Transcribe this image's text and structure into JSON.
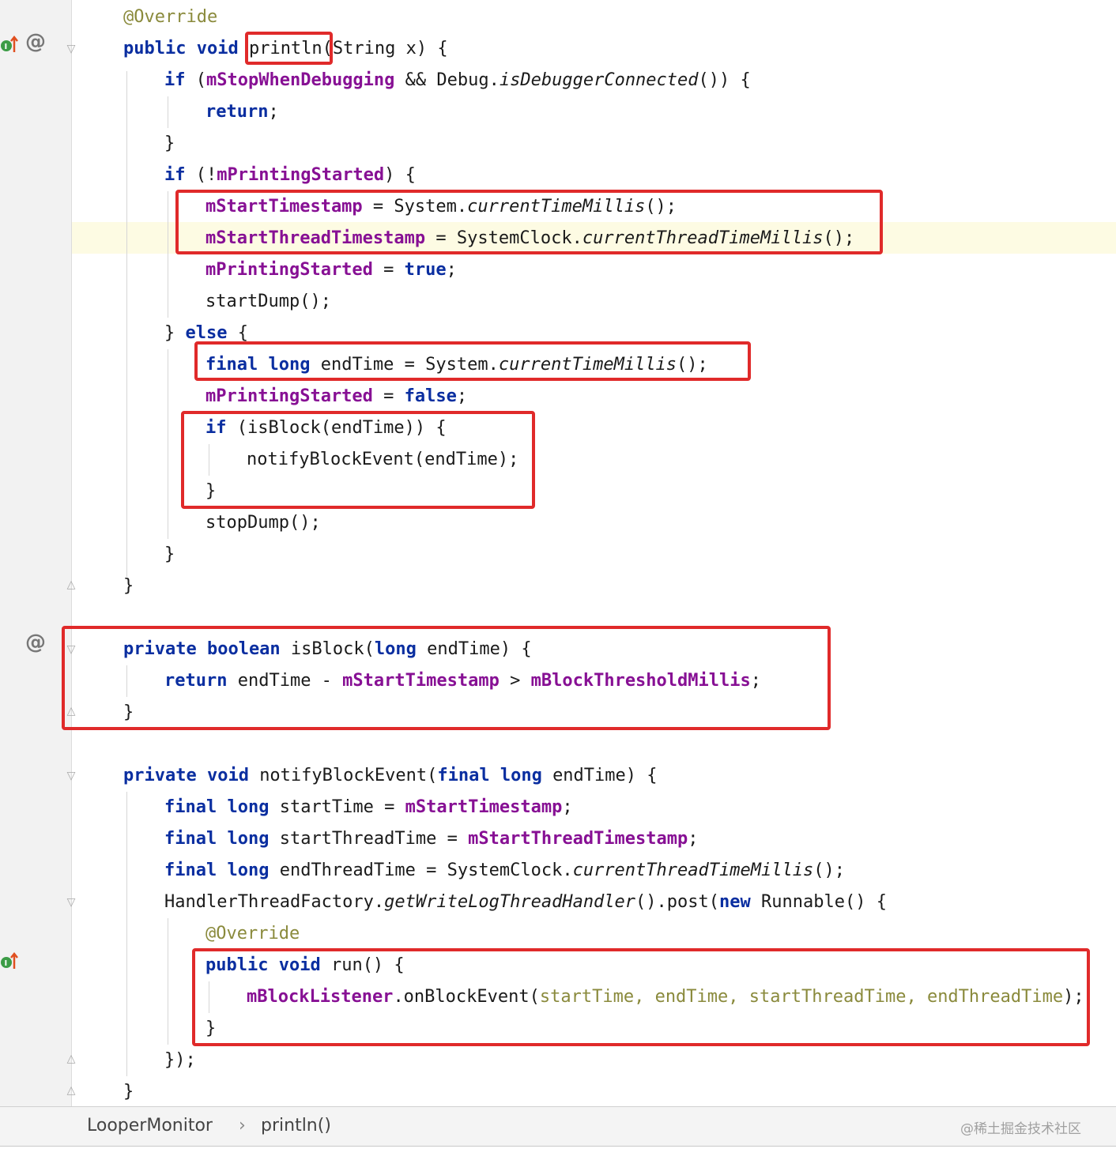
{
  "editor": {
    "lines": [
      {
        "code": [
          {
            "t": "@Override",
            "c": "ann"
          }
        ]
      },
      {
        "code": [
          {
            "t": "public void ",
            "c": "kw"
          },
          {
            "t": "println"
          },
          {
            "t": "(String x) {"
          }
        ]
      },
      {
        "code": [
          {
            "t": "if ",
            "c": "kw"
          },
          {
            "t": "("
          },
          {
            "t": "mStopWhenDebugging",
            "c": "fld"
          },
          {
            "t": " && Debug."
          },
          {
            "t": "isDebuggerConnected",
            "c": "it"
          },
          {
            "t": "()) {"
          }
        ]
      },
      {
        "code": [
          {
            "t": "return",
            "c": "kw"
          },
          {
            "t": ";"
          }
        ]
      },
      {
        "code": [
          {
            "t": "}"
          }
        ]
      },
      {
        "code": [
          {
            "t": "if ",
            "c": "kw"
          },
          {
            "t": "(!"
          },
          {
            "t": "mPrintingStarted",
            "c": "fld"
          },
          {
            "t": ") {"
          }
        ]
      },
      {
        "code": [
          {
            "t": "mStartTimestamp",
            "c": "fld"
          },
          {
            "t": " = System."
          },
          {
            "t": "currentTimeMillis",
            "c": "it"
          },
          {
            "t": "();"
          }
        ]
      },
      {
        "code": [
          {
            "t": "mStartThreadTimestamp",
            "c": "fld"
          },
          {
            "t": " = SystemClock."
          },
          {
            "t": "currentThreadTimeMillis",
            "c": "it"
          },
          {
            "t": "();"
          }
        ]
      },
      {
        "code": [
          {
            "t": "mPrintingStarted",
            "c": "fld"
          },
          {
            "t": " = "
          },
          {
            "t": "true",
            "c": "kw"
          },
          {
            "t": ";"
          }
        ]
      },
      {
        "code": [
          {
            "t": "startDump();"
          }
        ]
      },
      {
        "code": [
          {
            "t": "} "
          },
          {
            "t": "else",
            "c": "kw"
          },
          {
            "t": " {"
          }
        ]
      },
      {
        "code": [
          {
            "t": "final long ",
            "c": "kw"
          },
          {
            "t": "endTime = System."
          },
          {
            "t": "currentTimeMillis",
            "c": "it"
          },
          {
            "t": "();"
          }
        ]
      },
      {
        "code": [
          {
            "t": "mPrintingStarted",
            "c": "fld"
          },
          {
            "t": " = "
          },
          {
            "t": "false",
            "c": "kw"
          },
          {
            "t": ";"
          }
        ]
      },
      {
        "code": [
          {
            "t": "if ",
            "c": "kw"
          },
          {
            "t": "(isBlock(endTime)) {"
          }
        ]
      },
      {
        "code": [
          {
            "t": "notifyBlockEvent(endTime);"
          }
        ]
      },
      {
        "code": [
          {
            "t": "}"
          }
        ]
      },
      {
        "code": [
          {
            "t": "stopDump();"
          }
        ]
      },
      {
        "code": [
          {
            "t": "}"
          }
        ]
      },
      {
        "code": [
          {
            "t": "}"
          }
        ]
      },
      {
        "code": []
      },
      {
        "code": [
          {
            "t": "private boolean ",
            "c": "kw"
          },
          {
            "t": "isBlock("
          },
          {
            "t": "long ",
            "c": "kw"
          },
          {
            "t": "endTime) {"
          }
        ]
      },
      {
        "code": [
          {
            "t": "return ",
            "c": "kw"
          },
          {
            "t": "endTime - "
          },
          {
            "t": "mStartTimestamp",
            "c": "fld"
          },
          {
            "t": " > "
          },
          {
            "t": "mBlockThresholdMillis",
            "c": "fld"
          },
          {
            "t": ";"
          }
        ]
      },
      {
        "code": [
          {
            "t": "}"
          }
        ]
      },
      {
        "code": []
      },
      {
        "code": [
          {
            "t": "private void ",
            "c": "kw"
          },
          {
            "t": "notifyBlockEvent("
          },
          {
            "t": "final long ",
            "c": "kw"
          },
          {
            "t": "endTime) {"
          }
        ]
      },
      {
        "code": [
          {
            "t": "final long ",
            "c": "kw"
          },
          {
            "t": "startTime = "
          },
          {
            "t": "mStartTimestamp",
            "c": "fld"
          },
          {
            "t": ";"
          }
        ]
      },
      {
        "code": [
          {
            "t": "final long ",
            "c": "kw"
          },
          {
            "t": "startThreadTime = "
          },
          {
            "t": "mStartThreadTimestamp",
            "c": "fld"
          },
          {
            "t": ";"
          }
        ]
      },
      {
        "code": [
          {
            "t": "final long ",
            "c": "kw"
          },
          {
            "t": "endThreadTime = SystemClock."
          },
          {
            "t": "currentThreadTimeMillis",
            "c": "it"
          },
          {
            "t": "();"
          }
        ]
      },
      {
        "code": [
          {
            "t": "HandlerThreadFactory."
          },
          {
            "t": "getWriteLogThreadHandler",
            "c": "it"
          },
          {
            "t": "().post("
          },
          {
            "t": "new ",
            "c": "kw"
          },
          {
            "t": "Runnable() {"
          }
        ]
      },
      {
        "code": [
          {
            "t": "@Override",
            "c": "ann"
          }
        ]
      },
      {
        "code": [
          {
            "t": "public void ",
            "c": "kw"
          },
          {
            "t": "run() {"
          }
        ]
      },
      {
        "code": [
          {
            "t": "mBlockListener",
            "c": "fld"
          },
          {
            "t": ".onBlockEvent("
          },
          {
            "t": "startTime, endTime, startThreadTime, endThreadTime",
            "c": "ann"
          },
          {
            "t": ");"
          }
        ]
      },
      {
        "code": [
          {
            "t": "}"
          }
        ]
      },
      {
        "code": [
          {
            "t": "});"
          }
        ]
      },
      {
        "code": [
          {
            "t": "}"
          }
        ]
      }
    ]
  },
  "gutter": {
    "override_marker": "@",
    "implement_marker_icon": "implementing-method-icon"
  },
  "breadcrumb": {
    "class_name": "LooperMonitor",
    "separator": "›",
    "method_name": "println()"
  },
  "watermark": "@稀土掘金技术社区",
  "colors": {
    "keyword": "#0a2ea0",
    "field": "#871094",
    "annotation": "#8a8a3c",
    "highlight_box": "#e02a2a",
    "current_line": "#fdfbe3"
  }
}
